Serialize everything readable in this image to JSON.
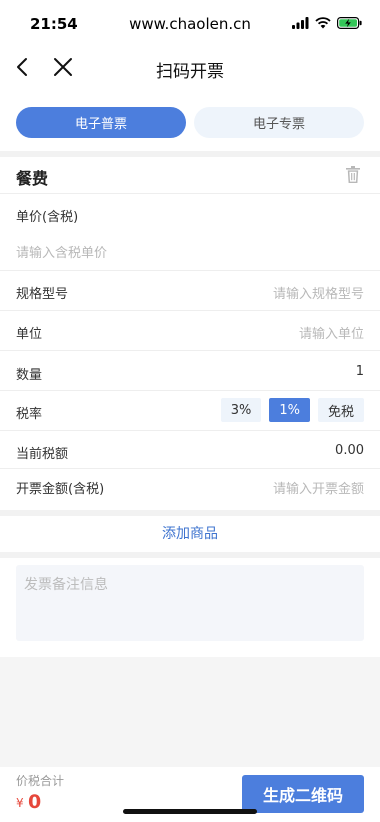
{
  "status_bar": {
    "time": "21:54",
    "url": "www.chaolen.cn"
  },
  "nav": {
    "title": "扫码开票"
  },
  "invoice_types": [
    "电子普票",
    "电子专票"
  ],
  "item": {
    "title": "餐费",
    "unit_price_label": "单价(含税)",
    "unit_price_placeholder": "请输入含税单价",
    "spec_label": "规格型号",
    "spec_placeholder": "请输入规格型号",
    "unit_label": "单位",
    "unit_placeholder": "请输入单位",
    "quantity_label": "数量",
    "quantity_value": "1",
    "tax_rate_label": "税率",
    "tax_rates": [
      "3%",
      "1%",
      "免税"
    ],
    "selected_tax_rate": "1%",
    "current_tax_label": "当前税额",
    "current_tax_value": "0.00",
    "invoice_amount_label": "开票金额(含税)",
    "invoice_amount_placeholder": "请输入开票金额"
  },
  "add_goods_label": "添加商品",
  "remark_placeholder": "发票备注信息",
  "footer": {
    "total_label": "价税合计",
    "currency": "¥",
    "total_amount": "0",
    "generate_label": "生成二维码"
  },
  "colors": {
    "accent": "#4c7edd",
    "price": "#e6473b",
    "link": "#3f74cf"
  }
}
